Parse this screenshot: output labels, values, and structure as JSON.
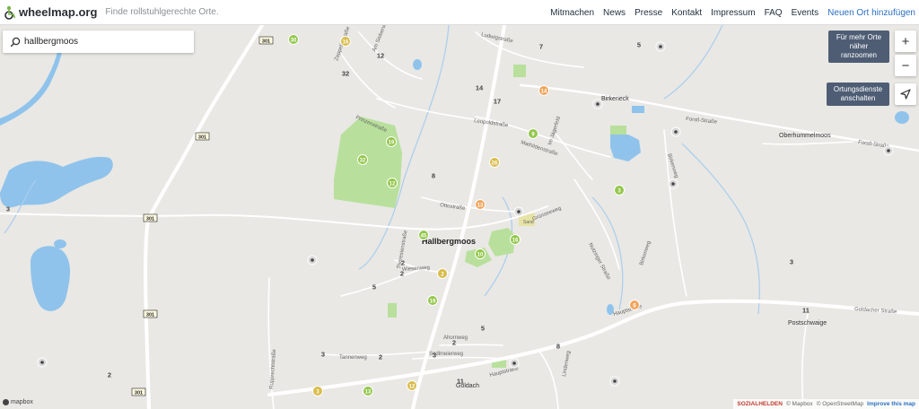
{
  "header": {
    "brand": "wheelmap.org",
    "tagline": "Finde rollstuhlgerechte Orte.",
    "nav": [
      "Mitmachen",
      "News",
      "Presse",
      "Kontakt",
      "Impressum",
      "FAQ",
      "Events"
    ],
    "cta": "Neuen Ort hinzufügen"
  },
  "search": {
    "value": "hallbergmoos"
  },
  "controls": {
    "zoom_in": "+",
    "zoom_out": "−",
    "zoom_tip": [
      "Für mehr Orte",
      "näher",
      "ranzoomen"
    ],
    "locate_tip": [
      "Ortungsdienste",
      "anschalten"
    ]
  },
  "map_labels": {
    "hallbergmoos": "Hallbergmoos",
    "birkeneck": "Birkeneck",
    "oberhummelmoos": "Oberhummelmoos",
    "postschwaige": "Postschwaige",
    "goldach": "Goldach",
    "zeppelinstrasse": "Zeppelinstraße",
    "am_sieberwaldweg": "Am Sieberwaldweg",
    "ludwigstrasse": "Ludwigstraße",
    "prinzenstrasse": "Prinzenstraße",
    "leopoldstrasse": "Leopoldstraße",
    "mathildenstrasse": "Mathildenstraße",
    "im_jagerfeld": "Im Jägerfeld",
    "forstlstrasse_1": "Forstl-Straße",
    "forstlstrasse_2": "Forstl-Straße",
    "ottostrasse": "Ottostraße",
    "theresienstrasse": "Theresienstraße",
    "wiesenweg": "Wiesenweg",
    "goldacher_strasse": "Goldacher Straße",
    "hauptstrasse_1": "Hauptstraße",
    "hauptstrasse_2": "Hauptstraße",
    "ahornweg": "Ahornweg",
    "tannenweg": "Tannenweg",
    "sedlmeierweg": "Sedlmeierweg",
    "lindenweg": "Lindenweg",
    "rupprechtstrasse": "Rupprechtstraße",
    "birkenweg": "Birkenweg",
    "birkenweg_2": "Birkenweg",
    "nutzinger_strasse": "Nutzinger Straße",
    "gruenseeweg": "Grünseeweg",
    "sand": "Sand"
  },
  "road_shields": [
    "301",
    "301",
    "301",
    "301",
    "301"
  ],
  "markers": [
    {
      "label": "30",
      "kind": "green"
    },
    {
      "label": "16",
      "kind": "yellow"
    },
    {
      "label": "12",
      "kind": "gray"
    },
    {
      "label": "32",
      "kind": "gray"
    },
    {
      "label": "7",
      "kind": "gray"
    },
    {
      "label": "5",
      "kind": "gray"
    },
    {
      "label": "14",
      "kind": "gray"
    },
    {
      "label": "17",
      "kind": "gray"
    },
    {
      "label": "14",
      "kind": "orange"
    },
    {
      "label": "19",
      "kind": "green"
    },
    {
      "label": "32",
      "kind": "green"
    },
    {
      "label": "12",
      "kind": "green"
    },
    {
      "label": "8",
      "kind": "gray"
    },
    {
      "label": "9",
      "kind": "green"
    },
    {
      "label": "26",
      "kind": "yellow"
    },
    {
      "label": "3",
      "kind": "green"
    },
    {
      "label": "13",
      "kind": "orange"
    },
    {
      "label": "45",
      "kind": "green"
    },
    {
      "label": "16",
      "kind": "green"
    },
    {
      "label": "10",
      "kind": "green"
    },
    {
      "label": "2",
      "kind": "yellow"
    },
    {
      "label": "19",
      "kind": "green"
    },
    {
      "label": "5",
      "kind": "gray"
    },
    {
      "label": "2",
      "kind": "gray"
    },
    {
      "label": "5",
      "kind": "gray"
    },
    {
      "label": "2",
      "kind": "gray"
    },
    {
      "label": "3",
      "kind": "gray"
    },
    {
      "label": "2",
      "kind": "gray"
    },
    {
      "label": "13",
      "kind": "green"
    },
    {
      "label": "12",
      "kind": "yellow"
    },
    {
      "label": "3",
      "kind": "yellow"
    },
    {
      "label": "11",
      "kind": "gray"
    },
    {
      "label": "8",
      "kind": "gray"
    },
    {
      "label": "3",
      "kind": "gray"
    },
    {
      "label": "3",
      "kind": "gray"
    },
    {
      "label": "11",
      "kind": "gray"
    },
    {
      "label": "6",
      "kind": "orange"
    },
    {
      "label": "2",
      "kind": "gray"
    },
    {
      "label": "2",
      "kind": "gray"
    },
    {
      "label": "3",
      "kind": "gray"
    }
  ],
  "attribution": {
    "brand": "SOZIALHELDEN",
    "mapbox": "© Mapbox",
    "osm": "© OpenStreetMap",
    "improve": "Improve this map",
    "logo": "mapbox"
  },
  "colors": {
    "land": "#e9e8e4",
    "park": "#a9d88b",
    "water": "#8fc3ec",
    "road": "#ffffff",
    "marker_green": "#93c74b",
    "marker_yellow": "#d9bc4b",
    "marker_orange": "#f2a55c",
    "marker_gray": "#e4e4e4",
    "accent": "#2b6fc2"
  }
}
